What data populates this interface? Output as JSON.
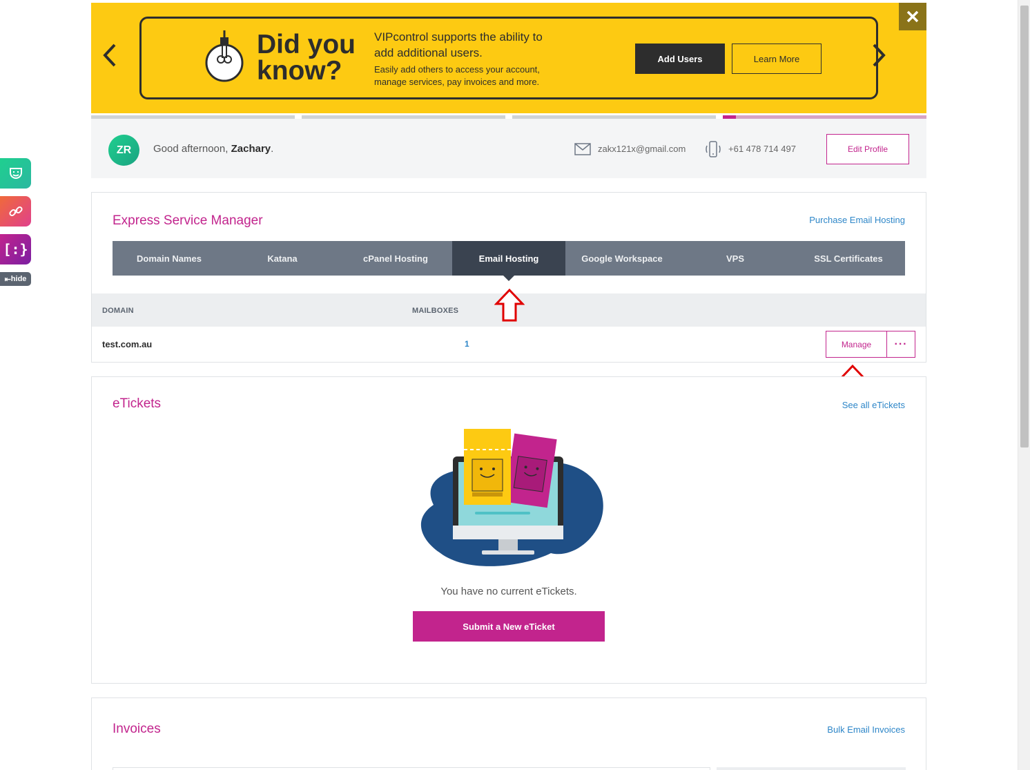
{
  "banner": {
    "headline": "Did you know?",
    "title": "VIPcontrol supports the ability to add additional users.",
    "subtitle": "Easily add others to access your account, manage services, pay invoices and more.",
    "add_users_label": "Add Users",
    "learn_more_label": "Learn More",
    "close_label": "✕",
    "prev_label": "‹",
    "next_label": "›",
    "slides_total": 4,
    "active_slide": 4
  },
  "side_tools": {
    "hide_label": "hide"
  },
  "profile": {
    "initials": "ZR",
    "greeting": "Good afternoon, ",
    "name": "Zachary",
    "greeting_end": ".",
    "email": "zakx121x@gmail.com",
    "phone": "+61 478 714 497",
    "edit_label": "Edit Profile"
  },
  "service_manager": {
    "title": "Express Service Manager",
    "link": "Purchase Email Hosting",
    "tabs": [
      {
        "label": "Domain Names"
      },
      {
        "label": "Katana"
      },
      {
        "label": "cPanel Hosting"
      },
      {
        "label": "Email Hosting",
        "active": true
      },
      {
        "label": "Google Workspace"
      },
      {
        "label": "VPS"
      },
      {
        "label": "SSL Certificates"
      }
    ],
    "columns": {
      "domain": "DOMAIN",
      "mailboxes": "MAILBOXES"
    },
    "rows": [
      {
        "domain": "test.com.au",
        "mailboxes": "1",
        "manage_label": "Manage",
        "more_label": "···"
      }
    ]
  },
  "etickets": {
    "title": "eTickets",
    "link": "See all eTickets",
    "empty_text": "You have no current eTickets.",
    "submit_label": "Submit a New eTicket"
  },
  "invoices": {
    "title": "Invoices",
    "link": "Bulk Email Invoices"
  },
  "colors": {
    "brand": "#c2248d",
    "banner": "#fdca12",
    "link": "#2d86c8",
    "tab": "#6e7886",
    "tab_active": "#3a4350"
  }
}
